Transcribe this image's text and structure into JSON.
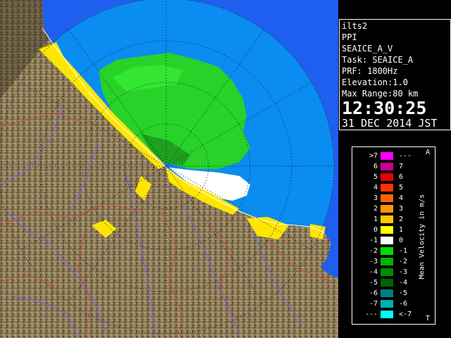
{
  "info": {
    "site": "ilts2",
    "product": "PPI",
    "product_name": "SEAICE_A_V",
    "task": "Task: SEAICE_A",
    "prf": "PRF: 1800Hz",
    "elevation": "Elevation:1.0",
    "max_range": "Max Range:80 km",
    "time": "12:30:25",
    "date": "31 DEC 2014 JST"
  },
  "legend": {
    "unit": "Mean Velocity in m/s",
    "corner_top": "A",
    "corner_bottom": "T",
    "rows": [
      {
        "left": ">7",
        "right": "---",
        "color": "#ff00ff"
      },
      {
        "left": "6",
        "right": "7",
        "color": "#c80096"
      },
      {
        "left": "5",
        "right": "6",
        "color": "#e60000"
      },
      {
        "left": "4",
        "right": "5",
        "color": "#ff3200"
      },
      {
        "left": "3",
        "right": "4",
        "color": "#ff6400"
      },
      {
        "left": "2",
        "right": "3",
        "color": "#ff9600"
      },
      {
        "left": "1",
        "right": "2",
        "color": "#ffc800"
      },
      {
        "left": "0",
        "right": "1",
        "color": "#ffff00"
      },
      {
        "left": "-1",
        "right": "0",
        "color": "#ffffff"
      },
      {
        "left": "-2",
        "right": "-1",
        "color": "#00dc00"
      },
      {
        "left": "-3",
        "right": "-2",
        "color": "#00b400"
      },
      {
        "left": "-4",
        "right": "-3",
        "color": "#008c00"
      },
      {
        "left": "-5",
        "right": "-4",
        "color": "#006400"
      },
      {
        "left": "-6",
        "right": "-5",
        "color": "#007d7d"
      },
      {
        "left": "-7",
        "right": "-6",
        "color": "#00afaf"
      },
      {
        "left": "---",
        "right": "<-7",
        "color": "#00ffff"
      }
    ]
  },
  "colors": {
    "sea": "#1e5ff0",
    "range": "#0a8cf0",
    "land": "#8a7a5a",
    "rivers": "#6060ff",
    "borders": "#c84040",
    "echo_green": "#28d228",
    "echo_yellow": "#ffe600"
  }
}
